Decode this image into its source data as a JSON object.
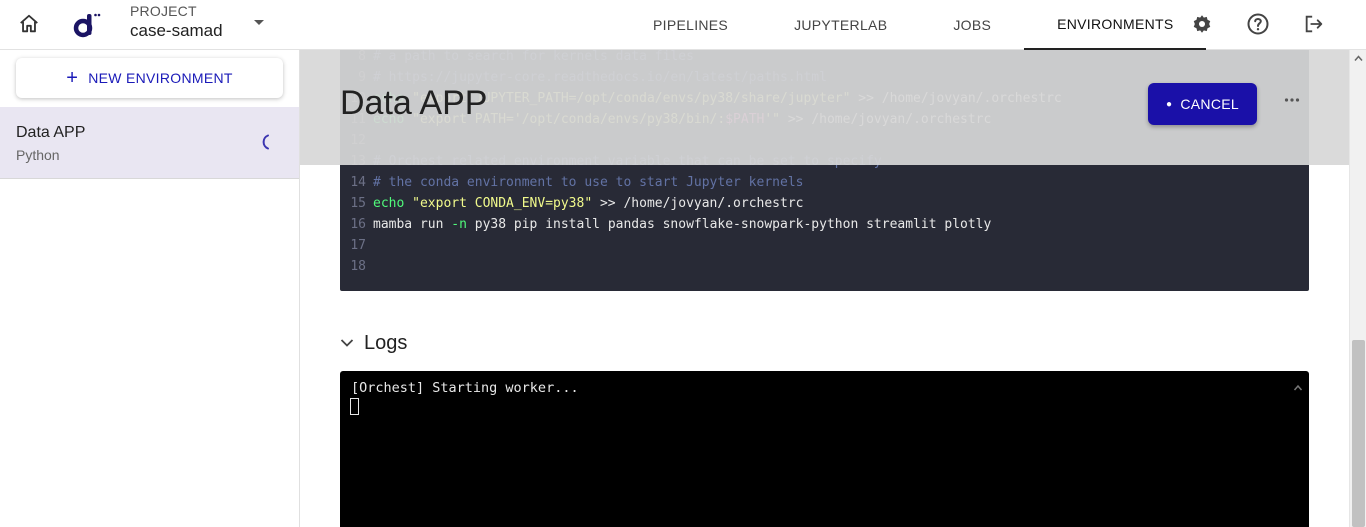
{
  "topbar": {
    "project_label": "PROJECT",
    "project_name": "case-samad",
    "nav": [
      "PIPELINES",
      "JUPYTERLAB",
      "JOBS",
      "ENVIRONMENTS"
    ],
    "active_tab": "ENVIRONMENTS",
    "icons": [
      "home-icon",
      "settings-icon",
      "help-icon",
      "logout-icon"
    ]
  },
  "sidebar": {
    "new_environment_label": "NEW ENVIRONMENT",
    "environments": [
      {
        "name": "Data APP",
        "language": "Python",
        "status": "building"
      }
    ]
  },
  "main": {
    "title": "Data APP",
    "cancel_label": "CANCEL",
    "code_lines": [
      {
        "n": "8",
        "parts": [
          [
            "c-comment",
            "# a path to search for kernels data files"
          ]
        ]
      },
      {
        "n": "9",
        "parts": [
          [
            "c-comment",
            "# https://jupyter-core.readthedocs.io/en/latest/paths.html"
          ]
        ]
      },
      {
        "n": "10",
        "parts": [
          [
            "c-fn",
            "echo "
          ],
          [
            "c-str",
            "\"export JUPYTER_PATH=/opt/conda/envs/py38/share/jupyter\""
          ],
          [
            "c-txt",
            " >> /home/jovyan/.orchestrc"
          ]
        ]
      },
      {
        "n": "11",
        "parts": [
          [
            "c-fn",
            "echo "
          ],
          [
            "c-str",
            "\"export PATH='/opt/conda/envs/py38/bin/:"
          ],
          [
            "c-var",
            "$PATH"
          ],
          [
            "c-str",
            "'\""
          ],
          [
            "c-txt",
            " >> /home/jovyan/.orchestrc"
          ]
        ]
      },
      {
        "n": "12",
        "parts": []
      },
      {
        "n": "13",
        "parts": [
          [
            "c-comment",
            "# Orchest related environment variable that can be set to specify"
          ]
        ]
      },
      {
        "n": "14",
        "parts": [
          [
            "c-comment",
            "# the conda environment to use to start Jupyter kernels"
          ]
        ]
      },
      {
        "n": "15",
        "parts": [
          [
            "c-fn",
            "echo "
          ],
          [
            "c-str",
            "\"export CONDA_ENV=py38\""
          ],
          [
            "c-txt",
            " >> /home/jovyan/.orchestrc"
          ]
        ]
      },
      {
        "n": "16",
        "parts": [
          [
            "c-txt",
            "mamba run "
          ],
          [
            "c-fn",
            "-n"
          ],
          [
            "c-txt",
            " py38 pip install pandas snowflake-snowpark-python streamlit plotly"
          ]
        ]
      },
      {
        "n": "17",
        "parts": []
      },
      {
        "n": "18",
        "parts": []
      }
    ],
    "logs_title": "Logs",
    "log_output": "[Orchest] Starting worker..."
  }
}
